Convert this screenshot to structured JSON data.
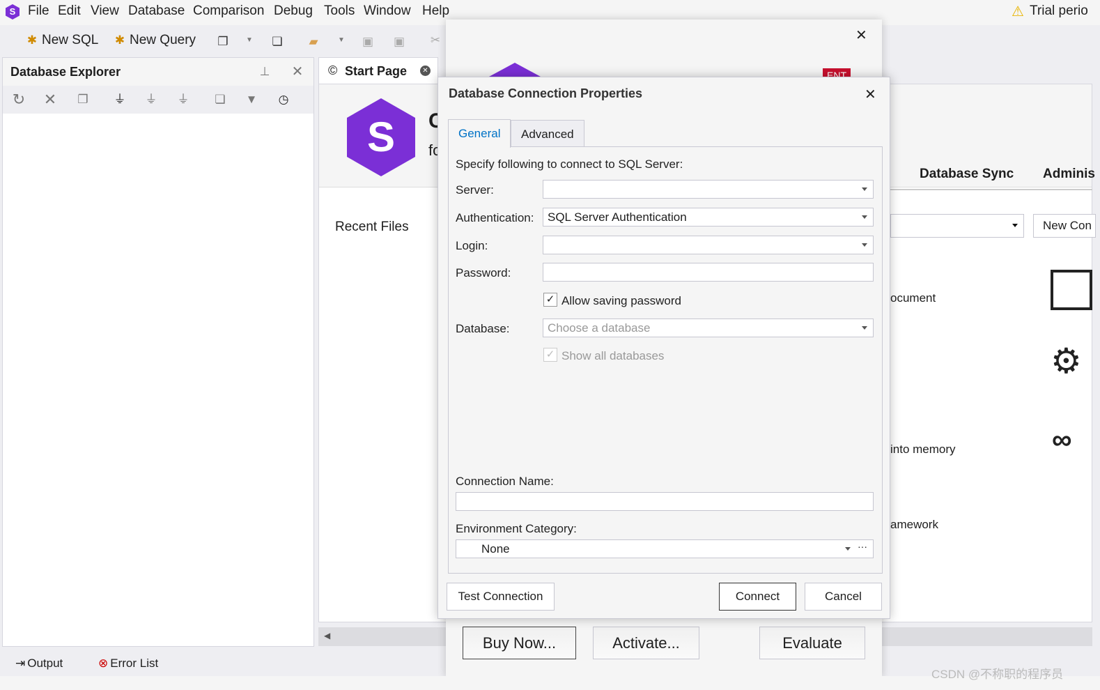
{
  "menu": [
    "File",
    "Edit",
    "View",
    "Database",
    "Comparison",
    "Debug",
    "Tools",
    "Window",
    "Help"
  ],
  "trial": "Trial perio",
  "toolbar": {
    "new_sql": "New SQL",
    "new_query": "New Query"
  },
  "explorer": {
    "title": "Database Explorer"
  },
  "start_tab": {
    "label": "Start Page",
    "recent": "Recent Files",
    "logo_initial": "C",
    "logo_sub": "fo"
  },
  "background": {
    "tab_sync": "Database Sync",
    "tab_admin": "Adminis",
    "new_con": "New Con",
    "text1": "ocument",
    "text2": "into memory",
    "text3": "amework"
  },
  "reg_dialog": {
    "badge": "ENT",
    "buy": "Buy Now...",
    "activate": "Activate...",
    "evaluate": "Evaluate"
  },
  "dialog": {
    "title": "Database Connection Properties",
    "tabs": [
      "General",
      "Advanced"
    ],
    "intro": "Specify following to connect to SQL Server:",
    "server_label": "Server:",
    "server_value": "",
    "auth_label": "Authentication:",
    "auth_value": "SQL Server Authentication",
    "login_label": "Login:",
    "login_value": "",
    "password_label": "Password:",
    "allow_saving": "Allow saving password",
    "database_label": "Database:",
    "database_placeholder": "Choose a database",
    "show_all": "Show all databases",
    "conn_name_label": "Connection Name:",
    "env_label": "Environment Category:",
    "env_value": "None",
    "test": "Test Connection",
    "connect": "Connect",
    "cancel": "Cancel"
  },
  "bottom": {
    "output": "Output",
    "errors": "Error List"
  },
  "watermark": "CSDN @不称职的程序员",
  "colors": {
    "accent": "#0072c6",
    "brand": "#7b2fd6",
    "badge": "#c8102e"
  }
}
